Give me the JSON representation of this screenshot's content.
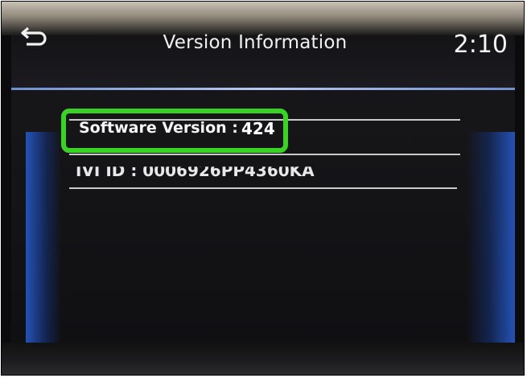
{
  "screen": {
    "title": "Version Information",
    "clock": "2:10",
    "back_icon": "back-arrow-icon"
  },
  "rows": [
    {
      "label": "Software Version :",
      "value": "424"
    },
    {
      "text": "IVI ID : 0006926PP4360KA"
    }
  ],
  "colors": {
    "highlight": "#39d324",
    "accent_blue": "#2456be",
    "screen_bg": "#101013"
  }
}
